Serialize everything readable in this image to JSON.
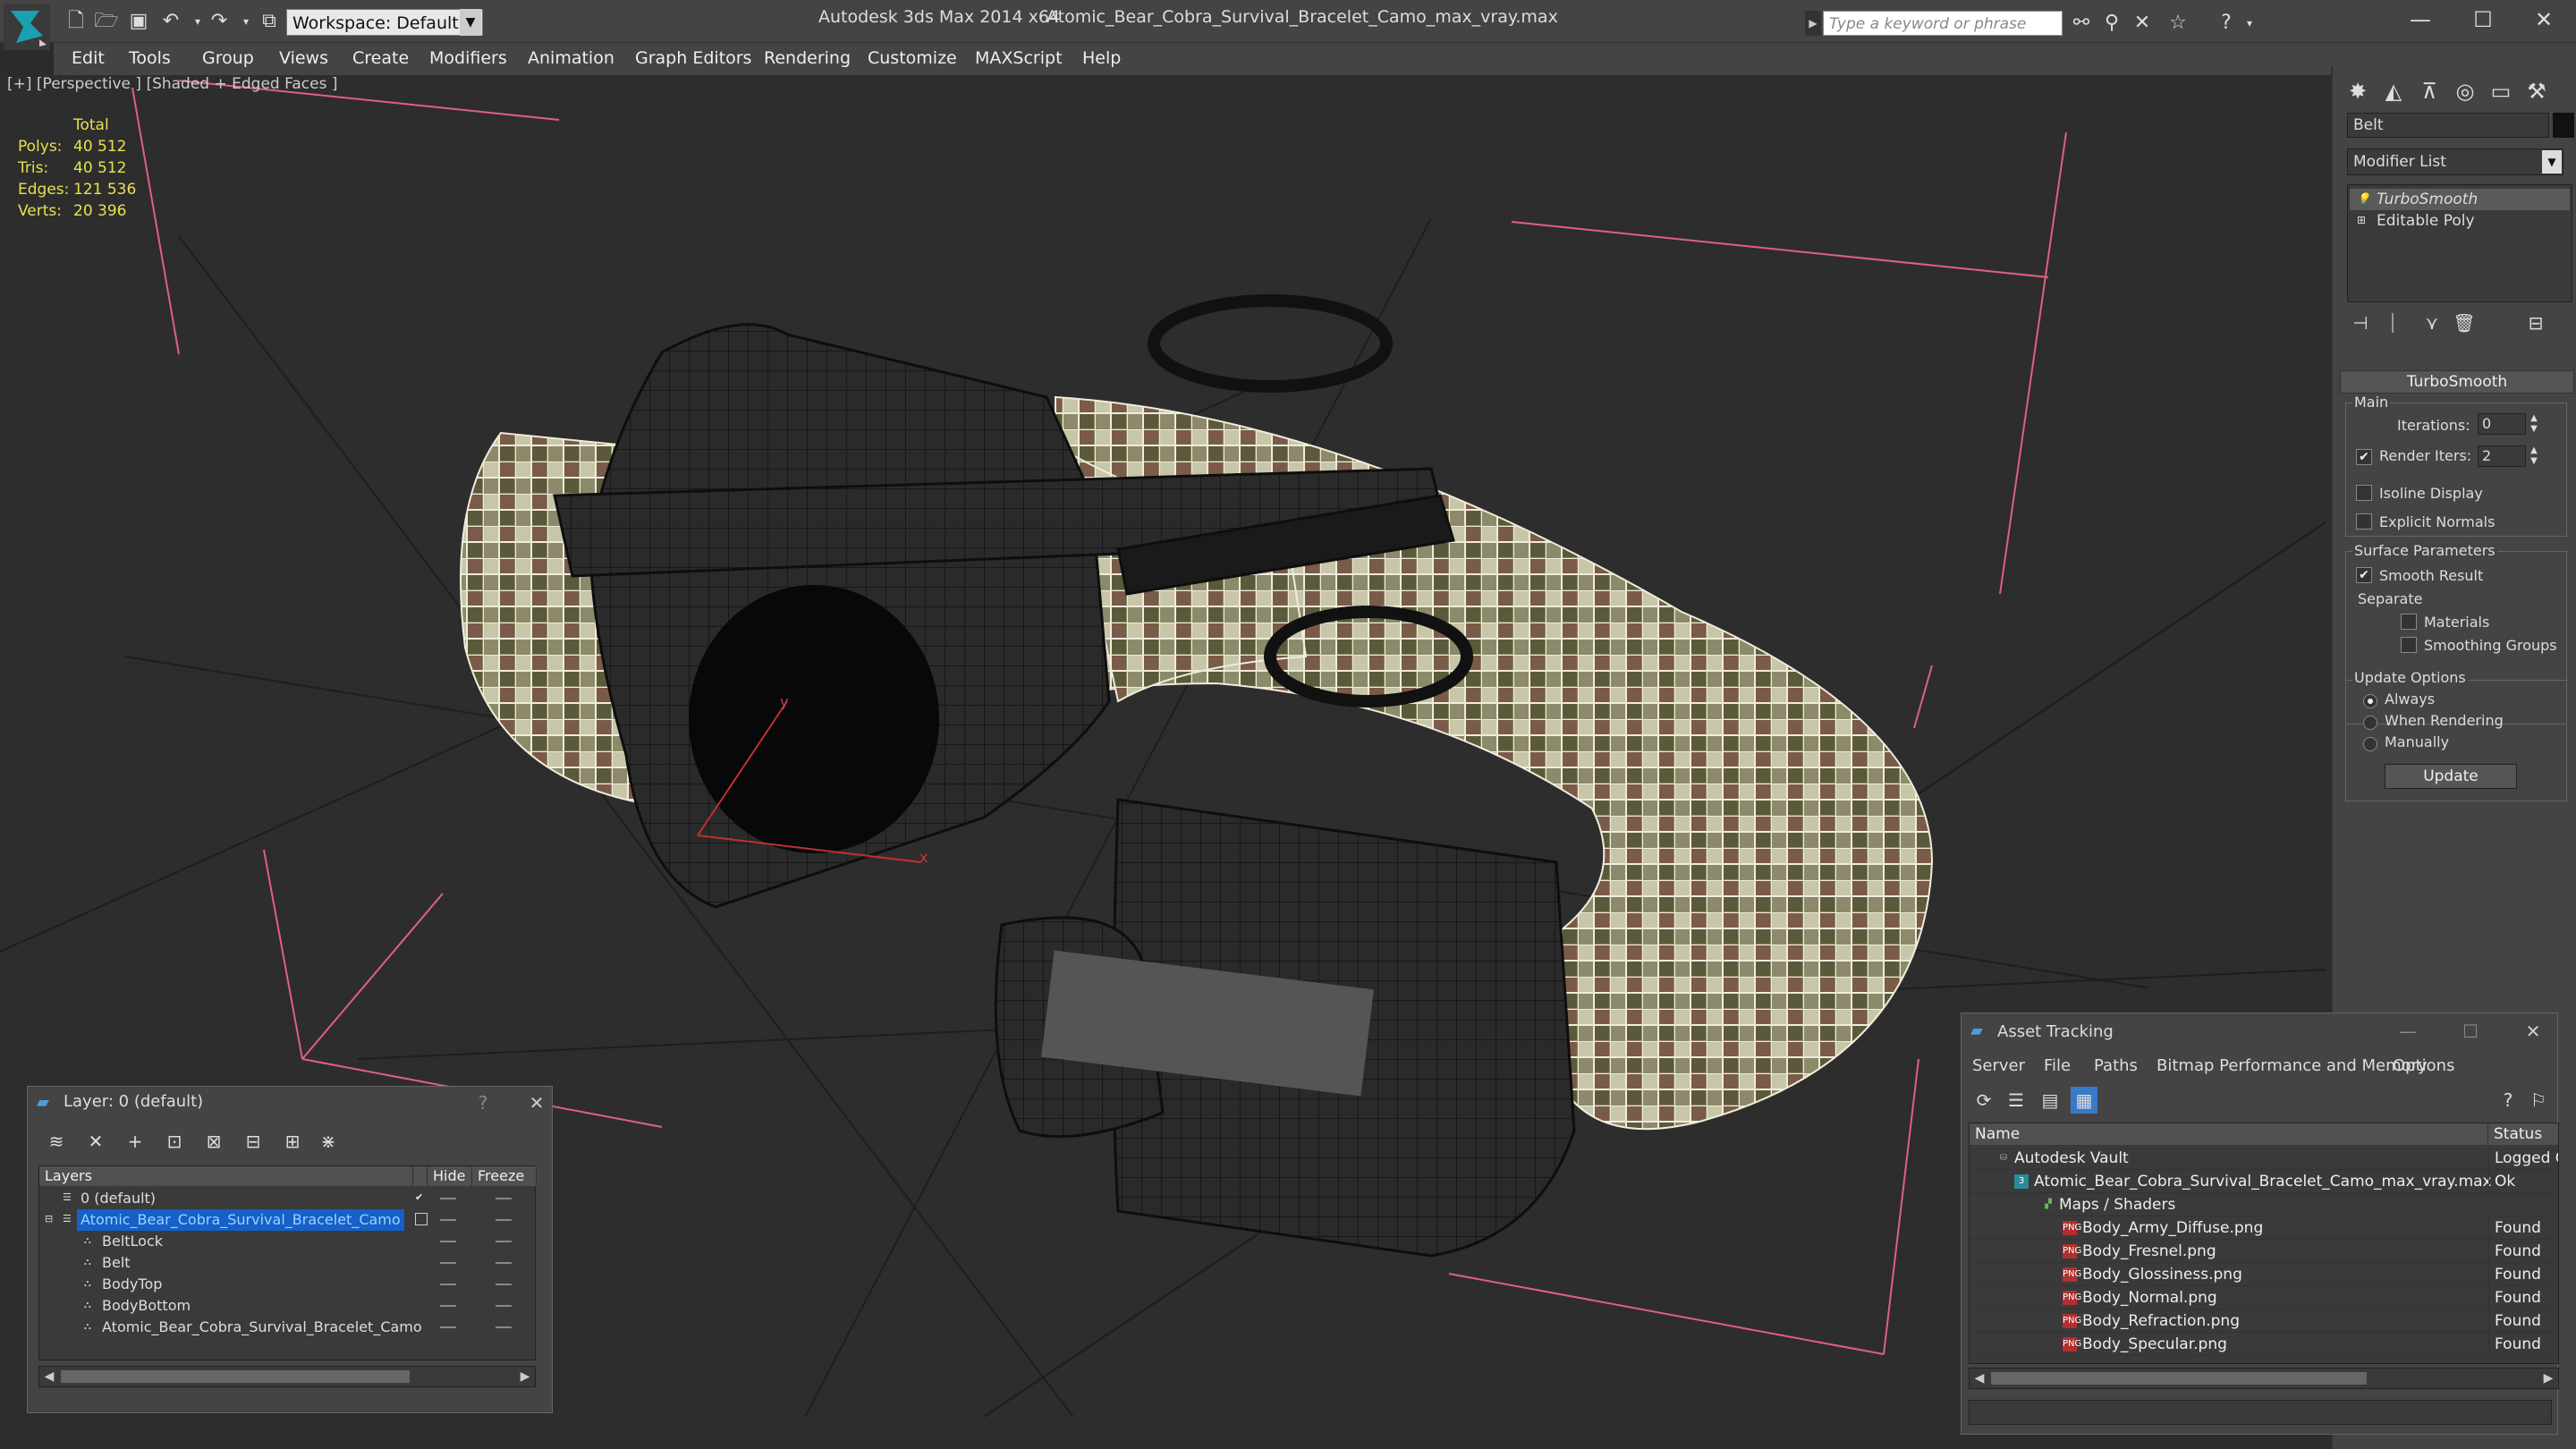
{
  "titlebar": {
    "workspace": "Workspace: Default",
    "app_title": "Autodesk 3ds Max  2014 x64",
    "file_title": "Atomic_Bear_Cobra_Survival_Bracelet_Camo_max_vray.max",
    "search_placeholder": "Type a keyword or phrase"
  },
  "menu": [
    "Edit",
    "Tools",
    "Group",
    "Views",
    "Create",
    "Modifiers",
    "Animation",
    "Graph Editors",
    "Rendering",
    "Customize",
    "MAXScript",
    "Help"
  ],
  "viewport": {
    "label": "[+] [Perspective ] [Shaded + Edged Faces ]",
    "stats_header": "Total",
    "stats": [
      {
        "k": "Polys:",
        "v": "40 512"
      },
      {
        "k": "Tris:",
        "v": "40 512"
      },
      {
        "k": "Edges:",
        "v": "121 536"
      },
      {
        "k": "Verts:",
        "v": "20 396"
      }
    ],
    "axis_x": "x",
    "axis_y": "y"
  },
  "cmdpanel": {
    "object_name": "Belt",
    "modifier_list": "Modifier List",
    "stack": [
      "TurboSmooth",
      "Editable Poly"
    ],
    "rollout_title": "TurboSmooth",
    "main_label": "Main",
    "iterations_label": "Iterations:",
    "iterations_value": "0",
    "render_iters_label": "Render Iters:",
    "render_iters_value": "2",
    "isoline": "Isoline Display",
    "explicit_normals": "Explicit Normals",
    "surface_params": "Surface Parameters",
    "smooth_result": "Smooth Result",
    "separate": "Separate",
    "materials": "Materials",
    "smoothing_groups": "Smoothing Groups",
    "update_options": "Update Options",
    "always": "Always",
    "when_rendering": "When Rendering",
    "manually": "Manually",
    "update_button": "Update"
  },
  "layer_dialog": {
    "title": "Layer: 0 (default)",
    "help": "?",
    "close": "✕",
    "col_layers": "Layers",
    "col_hide": "Hide",
    "col_freeze": "Freeze",
    "rows": [
      {
        "name": "0 (default)"
      },
      {
        "name": "Atomic_Bear_Cobra_Survival_Bracelet_Camo"
      },
      {
        "name": "BeltLock"
      },
      {
        "name": "Belt"
      },
      {
        "name": "BodyTop"
      },
      {
        "name": "BodyBottom"
      },
      {
        "name": "Atomic_Bear_Cobra_Survival_Bracelet_Camo"
      }
    ]
  },
  "asset_dialog": {
    "title": "Asset Tracking",
    "menu": [
      "Server",
      "File",
      "Paths",
      "Bitmap Performance and Memory",
      "Options"
    ],
    "col_name": "Name",
    "col_status": "Status",
    "rows": [
      {
        "name": "Autodesk Vault",
        "status": "Logged O"
      },
      {
        "name": "Atomic_Bear_Cobra_Survival_Bracelet_Camo_max_vray.max",
        "status": "Ok"
      },
      {
        "name": "Maps / Shaders",
        "status": ""
      },
      {
        "name": "Body_Army_Diffuse.png",
        "status": "Found"
      },
      {
        "name": "Body_Fresnel.png",
        "status": "Found"
      },
      {
        "name": "Body_Glossiness.png",
        "status": "Found"
      },
      {
        "name": "Body_Normal.png",
        "status": "Found"
      },
      {
        "name": "Body_Refraction.png",
        "status": "Found"
      },
      {
        "name": "Body_Specular.png",
        "status": "Found"
      }
    ]
  },
  "colors": {
    "selection": "#1560c9",
    "stats": "#e8e050",
    "axis_pink": "#e06080",
    "camo_light": "#e8e0c8",
    "camo_dark": "#4a4a30"
  }
}
